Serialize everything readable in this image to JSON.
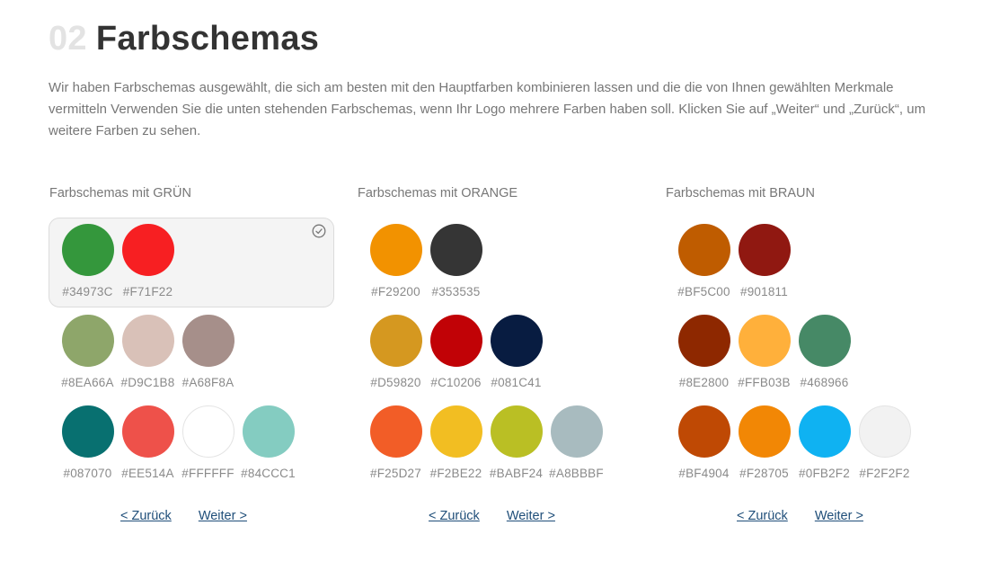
{
  "heading": {
    "number": "02",
    "title": "Farbschemas"
  },
  "intro": "Wir haben Farbschemas ausgewählt, die sich am besten mit den Hauptfarben kombinieren lassen und die die von Ihnen gewählten Merkmale vermitteln Verwenden Sie die unten stehenden Farbschemas, wenn Ihr Logo mehrere Farben haben soll. Klicken Sie auf „Weiter“ und „Zurück“, um weitere Farben zu sehen.",
  "columns": [
    {
      "title": "Farbschemas mit GRÜN",
      "back_label": "< Zurück",
      "next_label": "Weiter >",
      "schemes": [
        {
          "selected": true,
          "colors": [
            "#34973C",
            "#F71F22"
          ]
        },
        {
          "selected": false,
          "colors": [
            "#8EA66A",
            "#D9C1B8",
            "#A68F8A"
          ]
        },
        {
          "selected": false,
          "colors": [
            "#087070",
            "#EE514A",
            "#FFFFFF",
            "#84CCC1"
          ]
        }
      ]
    },
    {
      "title": "Farbschemas mit ORANGE",
      "back_label": "< Zurück",
      "next_label": "Weiter >",
      "schemes": [
        {
          "selected": false,
          "colors": [
            "#F29200",
            "#353535"
          ]
        },
        {
          "selected": false,
          "colors": [
            "#D59820",
            "#C10206",
            "#081C41"
          ]
        },
        {
          "selected": false,
          "colors": [
            "#F25D27",
            "#F2BE22",
            "#BABF24",
            "#A8BBBF"
          ]
        }
      ]
    },
    {
      "title": "Farbschemas mit BRAUN",
      "back_label": "< Zurück",
      "next_label": "Weiter >",
      "schemes": [
        {
          "selected": false,
          "colors": [
            "#BF5C00",
            "#901811"
          ]
        },
        {
          "selected": false,
          "colors": [
            "#8E2800",
            "#FFB03B",
            "#468966"
          ]
        },
        {
          "selected": false,
          "colors": [
            "#BF4904",
            "#F28705",
            "#0FB2F2",
            "#F2F2F2"
          ]
        }
      ]
    }
  ],
  "icons": {
    "selected_marker": "check-circle-icon"
  },
  "theme": {
    "link_color": "#1F4E79",
    "selected_bg": "#F4F4F4"
  }
}
